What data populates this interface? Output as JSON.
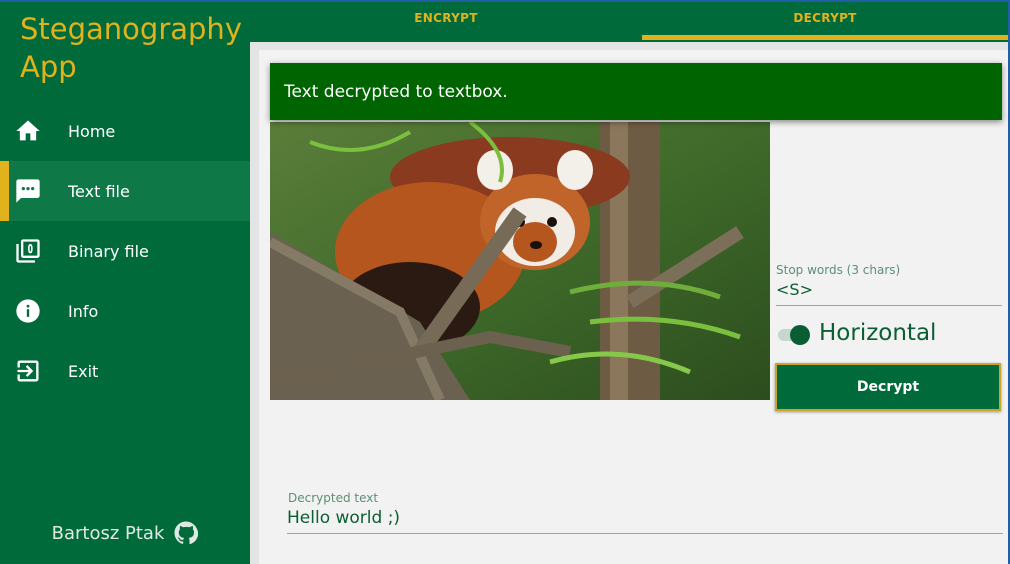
{
  "app": {
    "title": "Steganography App"
  },
  "sidebar": {
    "items": [
      {
        "label": "Home",
        "icon": "home-icon"
      },
      {
        "label": "Text file",
        "icon": "message-icon",
        "active": true
      },
      {
        "label": "Binary file",
        "icon": "binary-file-icon"
      },
      {
        "label": "Info",
        "icon": "info-icon"
      },
      {
        "label": "Exit",
        "icon": "exit-icon"
      }
    ],
    "footer": {
      "author": "Bartosz Ptak",
      "icon": "github-icon"
    }
  },
  "tabs": [
    {
      "label": "ENCRYPT",
      "active": false
    },
    {
      "label": "DECRYPT",
      "active": true
    }
  ],
  "snackbar": {
    "message": "Text decrypted to textbox."
  },
  "image": {
    "description_icon": "red-panda-photo"
  },
  "stop_words": {
    "label": "Stop words (3 chars)",
    "value": "<S>"
  },
  "orientation": {
    "label": "Horizontal",
    "enabled": true
  },
  "decrypt_button": {
    "label": "Decrypt"
  },
  "decrypted_text": {
    "label": "Decrypted text",
    "value": "Hello world ;)"
  },
  "colors": {
    "primary": "#006a3b",
    "accent": "#e0b21c",
    "snackbar": "#006400",
    "panel": "#f2f2f2"
  }
}
